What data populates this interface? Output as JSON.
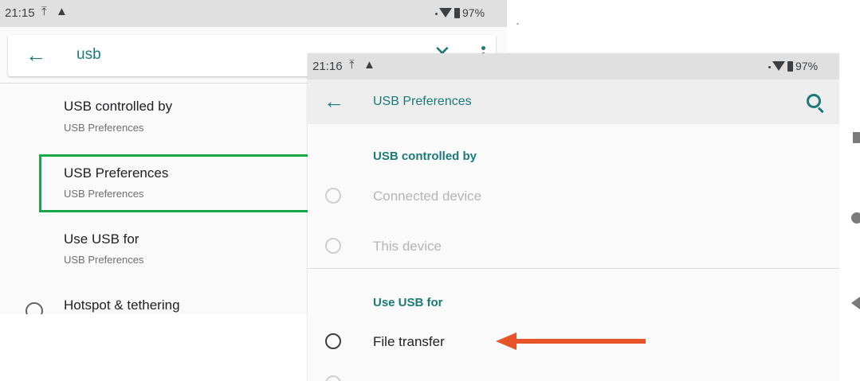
{
  "left_screen": {
    "status": {
      "time": "21:15",
      "upload_icon": "upload-arrow-icon",
      "alert_icon": "warning-icon",
      "battery": "97%"
    },
    "search": {
      "query": "usb",
      "back_icon": "back-arrow-icon",
      "clear_icon": "close-icon",
      "menu_icon": "more-vert-icon"
    },
    "results": [
      {
        "title": "USB controlled by",
        "subtitle": "USB Preferences"
      },
      {
        "title": "USB Preferences",
        "subtitle": "USB Preferences"
      },
      {
        "title": "Use USB for",
        "subtitle": "USB Preferences"
      },
      {
        "title": "Hotspot & tethering",
        "subtitle": ""
      }
    ]
  },
  "right_screen": {
    "status": {
      "time": "21:16",
      "upload_icon": "upload-arrow-icon",
      "alert_icon": "warning-icon",
      "battery": "97%"
    },
    "app_bar": {
      "title": "USB Preferences",
      "back_icon": "back-arrow-icon",
      "search_icon": "search-icon"
    },
    "sections": [
      {
        "header": "USB controlled by",
        "options": [
          "Connected device",
          "This device"
        ]
      },
      {
        "header": "Use USB for",
        "options": [
          "File transfer"
        ]
      }
    ]
  },
  "annotations": {
    "highlight_color": "#18a84a",
    "arrow_color": "#e8532a"
  },
  "colors": {
    "accent": "#1a7a78"
  }
}
